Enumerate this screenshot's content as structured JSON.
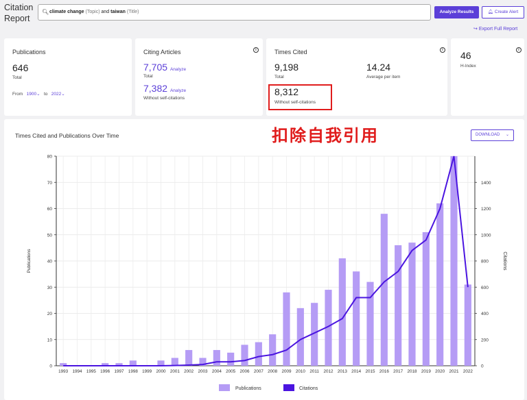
{
  "header": {
    "title_line1": "Citation",
    "title_line2": "Report",
    "query_term1": "climate change",
    "query_field1": "(Topic)",
    "query_op": "and",
    "query_term2": "taiwan",
    "query_field2": "(Title)",
    "analyze_label": "Analyze Results",
    "alert_label": "Create Alert",
    "export_label": "Export Full Report"
  },
  "publications": {
    "title": "Publications",
    "value": "646",
    "value_label": "Total",
    "from_label": "From",
    "from_value": "1900",
    "to_label": "to",
    "to_value": "2022"
  },
  "citing": {
    "title": "Citing Articles",
    "total": "7,705",
    "total_link": "Analyze",
    "total_label": "Total",
    "noself": "7,382",
    "noself_link": "Analyze",
    "noself_label": "Without self-citations"
  },
  "times_cited": {
    "title": "Times Cited",
    "total": "9,198",
    "total_label": "Total",
    "avg": "14.24",
    "avg_label": "Average per item",
    "noself": "8,312",
    "noself_label": "Without self-citations"
  },
  "hindex": {
    "value": "46",
    "label": "H-Index"
  },
  "annotation": "扣除自我引用",
  "chart": {
    "title": "Times Cited and Publications Over Time",
    "download_label": "DOWNLOAD"
  },
  "chart_data": {
    "type": "bar",
    "x": [
      "1993",
      "1994",
      "1995",
      "1996",
      "1997",
      "1998",
      "1999",
      "2000",
      "2001",
      "2002",
      "2003",
      "2004",
      "2005",
      "2006",
      "2007",
      "2008",
      "2009",
      "2010",
      "2011",
      "2012",
      "2013",
      "2014",
      "2015",
      "2016",
      "2017",
      "2018",
      "2019",
      "2020",
      "2021",
      "2022"
    ],
    "series": [
      {
        "name": "Publications",
        "type": "bar",
        "axis": "left",
        "color": "#b59cf5",
        "values": [
          1,
          0,
          0,
          1,
          1,
          2,
          0,
          2,
          3,
          6,
          3,
          6,
          5,
          8,
          9,
          12,
          28,
          22,
          24,
          29,
          41,
          36,
          32,
          58,
          46,
          47,
          51,
          62,
          80,
          31
        ]
      },
      {
        "name": "Citations",
        "type": "line",
        "axis": "right",
        "color": "#4a14e0",
        "values": [
          0,
          0,
          0,
          0,
          0,
          0,
          0,
          0,
          2,
          5,
          10,
          30,
          30,
          40,
          70,
          85,
          120,
          200,
          250,
          300,
          360,
          520,
          520,
          640,
          720,
          880,
          960,
          1200,
          1600,
          600
        ]
      }
    ],
    "ylabel": "Publications",
    "y2label": "Citations",
    "ylim": [
      0,
      80
    ],
    "y2lim": [
      0,
      1600
    ],
    "yticks": [
      0,
      10,
      20,
      30,
      40,
      50,
      60,
      70,
      80
    ],
    "y2ticks": [
      0,
      200,
      400,
      600,
      800,
      1000,
      1200,
      1400
    ],
    "legend_position": "bottom",
    "grid": true
  }
}
